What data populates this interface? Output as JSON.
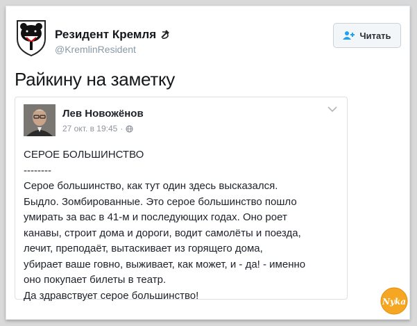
{
  "tweet": {
    "author_name": "Резидент Кремля",
    "author_handle": "@KremlinResident",
    "follow_label": "Читать",
    "text": "Райкину на заметку",
    "icons": {
      "avatar": "bear-shield-icon",
      "name_emoji": "hammer-sickle-icon",
      "follow": "add-user-icon"
    }
  },
  "embed": {
    "author_name": "Лев Новожёнов",
    "timestamp": "27 окт. в 19:45",
    "separator": "·",
    "privacy_icon": "globe-icon",
    "menu_icon": "chevron-down-icon",
    "lines": [
      "СЕРОЕ БОЛЬШИНСТВО",
      "--------",
      "Серое большинство, как тут один здесь высказался.",
      "Быдло. Зомбированные. Это серое большинство пошло",
      "умирать за вас в 41-м и последующих годах. Оно роет",
      "канавы, строит дома и дороги, водит самолёты и поезда,",
      "лечит, преподаёт, вытаскивает из горящего дома,",
      "убирает ваше говно, выживает, как может, и - да! - именно",
      "оно покупает билеты в театр.",
      "Да здравствует серое большинство!"
    ]
  },
  "watermark": {
    "text": "Nyka",
    "color": "#f5a623"
  },
  "colors": {
    "accent": "#1da1f2",
    "handle": "#8899a6",
    "fb_meta": "#90949c"
  }
}
